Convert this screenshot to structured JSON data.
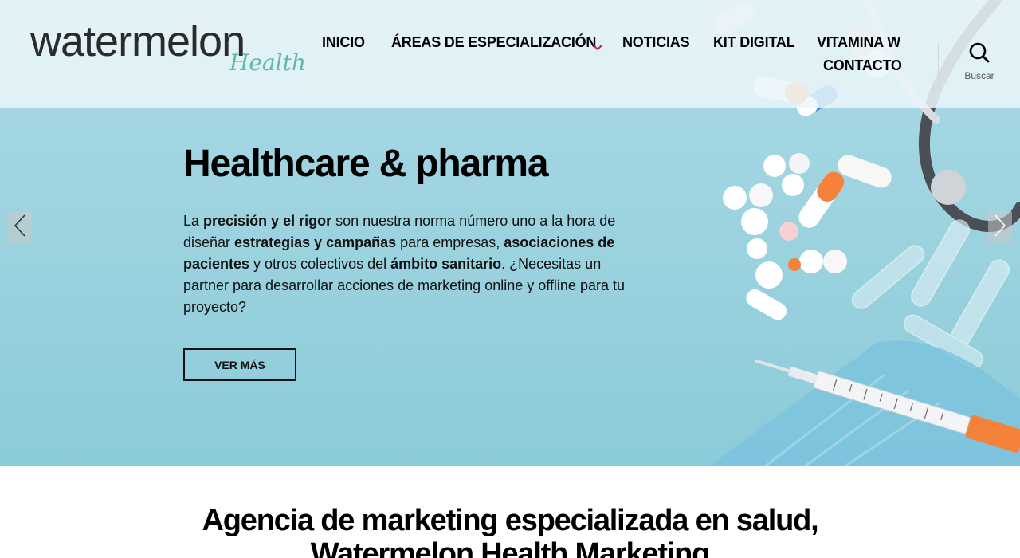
{
  "header": {
    "logo_word": "watermelon",
    "logo_sub": "Health",
    "nav": [
      "INICIO",
      "ÁREAS DE ESPECIALIZACIÓN",
      "NOTICIAS",
      "KIT DIGITAL",
      "VITAMINA W",
      "CONTACTO"
    ],
    "search_label": "Buscar"
  },
  "hero": {
    "title": "Healthcare & pharma",
    "paragraph": [
      {
        "t": "La ",
        "b": false
      },
      {
        "t": "precisión y el rigor",
        "b": true
      },
      {
        "t": " son nuestra norma número uno a la hora de diseñar ",
        "b": false
      },
      {
        "t": "estrategias y campañas",
        "b": true
      },
      {
        "t": " para empresas, ",
        "b": false
      },
      {
        "t": "asociaciones de pacientes",
        "b": true
      },
      {
        "t": " y otros colectivos del ",
        "b": false
      },
      {
        "t": "ámbito sanitario",
        "b": true
      },
      {
        "t": ". ¿Necesitas un partner para desarrollar acciones de marketing online y offline para tu proyecto?",
        "b": false
      }
    ],
    "button_label": "VER MÁS"
  },
  "section": {
    "title_line1": "Agencia de marketing especializada en salud,",
    "title_line2": "Watermelon Health Marketing"
  },
  "colors": {
    "hero_bg": "#9fd4e0",
    "logo_accent": "#5fb8a9",
    "chevron": "#c0284a",
    "text": "#000000"
  },
  "icons": [
    "search-icon",
    "chevron-down-icon",
    "arrow-left-icon",
    "arrow-right-icon"
  ]
}
